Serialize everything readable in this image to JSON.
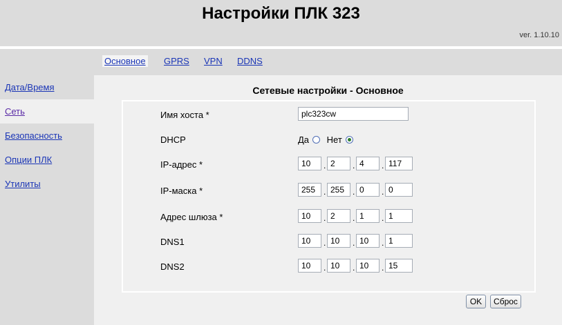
{
  "header": {
    "title": "Настройки ПЛК 323",
    "version": "ver. 1.10.10"
  },
  "sidebar": {
    "items": [
      {
        "label": "Дата/Время"
      },
      {
        "label": "Сеть"
      },
      {
        "label": "Безопасность"
      },
      {
        "label": "Опции ПЛК"
      },
      {
        "label": "Утилиты"
      }
    ],
    "active": "Сеть"
  },
  "tabs": [
    {
      "label": "Основное"
    },
    {
      "label": "GPRS"
    },
    {
      "label": "VPN"
    },
    {
      "label": "DDNS"
    }
  ],
  "active_tab": "Основное",
  "section_title": "Сетевые настройки - Основное",
  "form": {
    "hostname": {
      "label": "Имя хоста *",
      "value": "plc323cw"
    },
    "dhcp": {
      "label": "DHCP",
      "yes_label": "Да",
      "no_label": "Нет",
      "selected": "Нет"
    },
    "ip": {
      "label": "IP-адрес *",
      "octets": [
        "10",
        "2",
        "4",
        "117"
      ]
    },
    "mask": {
      "label": "IP-маска *",
      "octets": [
        "255",
        "255",
        "0",
        "0"
      ]
    },
    "gateway": {
      "label": "Адрес шлюза *",
      "octets": [
        "10",
        "2",
        "1",
        "1"
      ]
    },
    "dns1": {
      "label": "DNS1",
      "octets": [
        "10",
        "10",
        "10",
        "1"
      ]
    },
    "dns2": {
      "label": "DNS2",
      "octets": [
        "10",
        "10",
        "10",
        "15"
      ]
    }
  },
  "buttons": {
    "ok": "OK",
    "reset": "Сброс"
  },
  "colors": {
    "link": "#1a35b6",
    "visited_link": "#5a2aa6",
    "panel": "#dcdcdc",
    "content": "#f0f0f0"
  }
}
